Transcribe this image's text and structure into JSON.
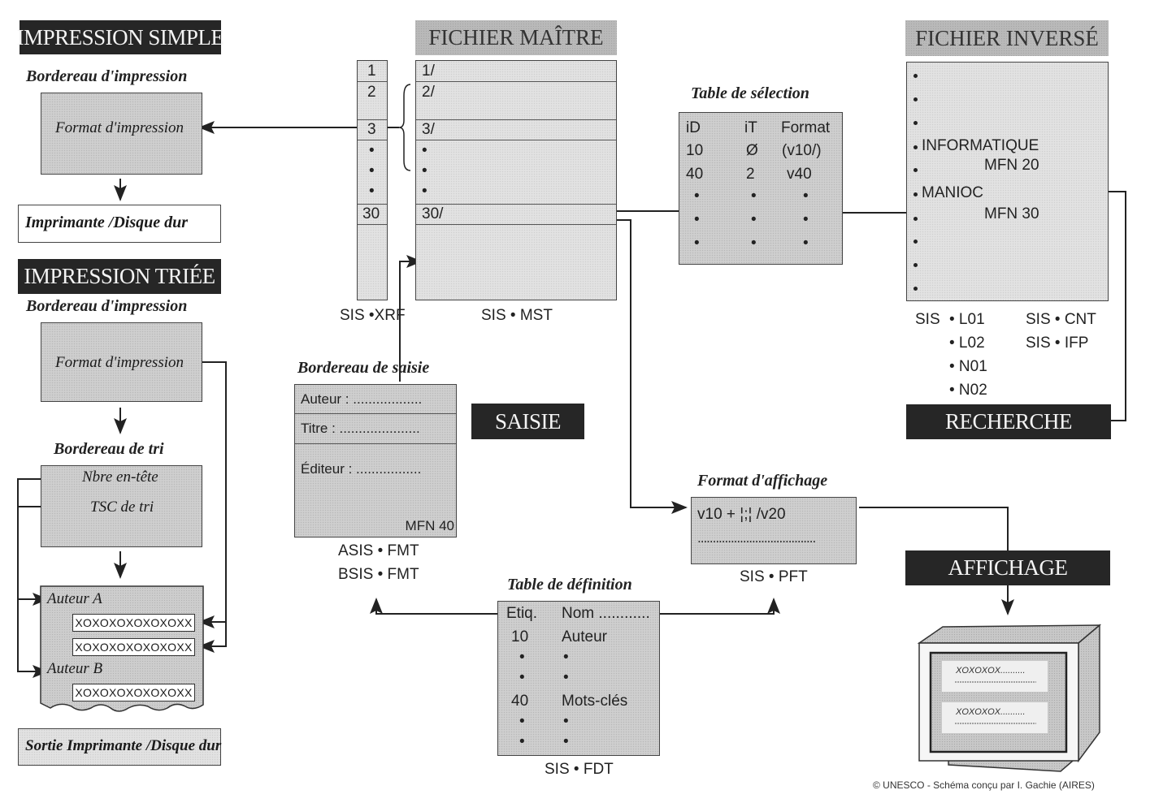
{
  "impression_simple": {
    "banner": "IMPRESSION SIMPLE",
    "caption": "Bordereau d'impression",
    "format_label": "Format d'impression",
    "output_label": "Imprimante /Disque dur"
  },
  "impression_triee": {
    "banner": "IMPRESSION TRIÉE",
    "caption": "Bordereau d'impression",
    "format_label": "Format d'impression",
    "sort_caption": "Bordereau de tri",
    "sort_items": [
      "Nbre en-tête",
      "TSC de tri"
    ],
    "output_sheet": {
      "groups": [
        {
          "label": "Auteur A",
          "records": [
            "XOXOXOXOXOXOXX",
            "XOXOXOXOXOXOXX"
          ]
        },
        {
          "label": "Auteur B",
          "records": [
            "XOXOXOXOXOXOXX"
          ]
        }
      ]
    },
    "output_label": "Sortie Imprimante /Disque dur"
  },
  "fichier_maitre": {
    "banner": "FICHIER MAÎTRE",
    "xrf_entries": [
      "1",
      "2",
      "3",
      "•",
      "•",
      "•",
      "30"
    ],
    "mst_entries": [
      "1/",
      "2/",
      "3/",
      "•",
      "•",
      "•",
      "30/"
    ],
    "xrf_label": "SIS •XRF",
    "mst_label": "SIS • MST"
  },
  "table_selection": {
    "caption": "Table de sélection",
    "headers": [
      "iD",
      "iT",
      "Format"
    ],
    "rows": [
      [
        "10",
        "Ø",
        "(v10/)"
      ],
      [
        "40",
        "2",
        "v40"
      ],
      [
        "•",
        "•",
        "•"
      ],
      [
        "•",
        "•",
        "•"
      ],
      [
        "•",
        "•",
        "•"
      ]
    ]
  },
  "fichier_inverse": {
    "banner": "FICHIER INVERSÉ",
    "terms": [
      {
        "term": "",
        "mfn": ""
      },
      {
        "term": "",
        "mfn": ""
      },
      {
        "term": "",
        "mfn": ""
      },
      {
        "term": "INFORMATIQUE",
        "mfn": "MFN 20"
      },
      {
        "term": "MANIOC",
        "mfn": "MFN 30"
      }
    ],
    "bullet": "•",
    "files_prefix": "SIS",
    "files_left": [
      "• L01",
      "• L02",
      "• N01",
      "• N02"
    ],
    "files_right": [
      "SIS • CNT",
      "SIS • IFP"
    ]
  },
  "recherche": {
    "banner": "RECHERCHE"
  },
  "saisie": {
    "banner": "SAISIE",
    "caption": "Bordereau de saisie",
    "fields": [
      "Auteur : ..................",
      "Titre : .....................",
      "Éditeur : ................."
    ],
    "mfn": "MFN 40",
    "files": [
      "ASIS • FMT",
      "BSIS • FMT"
    ]
  },
  "format_affichage": {
    "caption": "Format d'affichage",
    "line1": "v10 + ¦;¦ /v20",
    "line2": ".......................................",
    "file": "SIS • PFT"
  },
  "table_definition": {
    "caption": "Table de définition",
    "headers": [
      "Etiq.",
      "Nom ............"
    ],
    "rows": [
      [
        "10",
        "Auteur"
      ],
      [
        "•",
        "•"
      ],
      [
        "•",
        "•"
      ],
      [
        "40",
        "Mots-clés"
      ],
      [
        "•",
        "•"
      ],
      [
        "•",
        "•"
      ]
    ],
    "file": "SIS • FDT"
  },
  "affichage": {
    "banner": "AFFICHAGE",
    "screen_lines": [
      "XOXOXOX..........",
      "XOXOXOX.........."
    ]
  },
  "credit": "© UNESCO - Schéma conçu par I. Gachie (AIRES)"
}
